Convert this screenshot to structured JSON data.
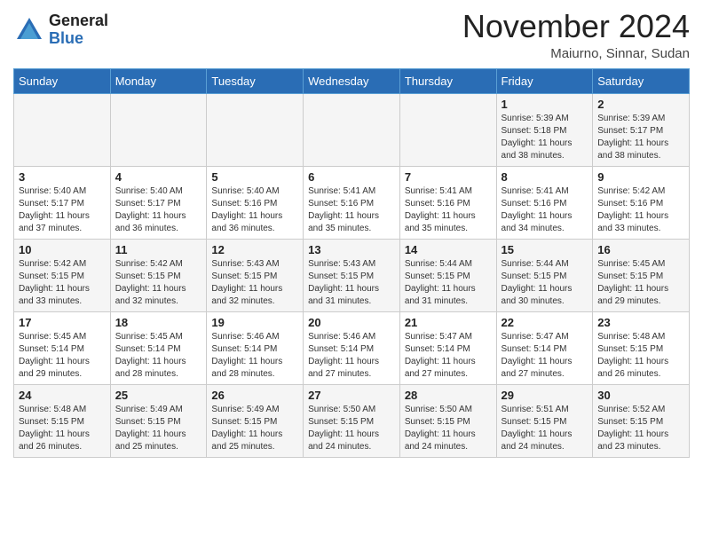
{
  "logo": {
    "general": "General",
    "blue": "Blue"
  },
  "header": {
    "month": "November 2024",
    "location": "Maiurno, Sinnar, Sudan"
  },
  "weekdays": [
    "Sunday",
    "Monday",
    "Tuesday",
    "Wednesday",
    "Thursday",
    "Friday",
    "Saturday"
  ],
  "weeks": [
    [
      {
        "day": "",
        "detail": ""
      },
      {
        "day": "",
        "detail": ""
      },
      {
        "day": "",
        "detail": ""
      },
      {
        "day": "",
        "detail": ""
      },
      {
        "day": "",
        "detail": ""
      },
      {
        "day": "1",
        "detail": "Sunrise: 5:39 AM\nSunset: 5:18 PM\nDaylight: 11 hours\nand 38 minutes."
      },
      {
        "day": "2",
        "detail": "Sunrise: 5:39 AM\nSunset: 5:17 PM\nDaylight: 11 hours\nand 38 minutes."
      }
    ],
    [
      {
        "day": "3",
        "detail": "Sunrise: 5:40 AM\nSunset: 5:17 PM\nDaylight: 11 hours\nand 37 minutes."
      },
      {
        "day": "4",
        "detail": "Sunrise: 5:40 AM\nSunset: 5:17 PM\nDaylight: 11 hours\nand 36 minutes."
      },
      {
        "day": "5",
        "detail": "Sunrise: 5:40 AM\nSunset: 5:16 PM\nDaylight: 11 hours\nand 36 minutes."
      },
      {
        "day": "6",
        "detail": "Sunrise: 5:41 AM\nSunset: 5:16 PM\nDaylight: 11 hours\nand 35 minutes."
      },
      {
        "day": "7",
        "detail": "Sunrise: 5:41 AM\nSunset: 5:16 PM\nDaylight: 11 hours\nand 35 minutes."
      },
      {
        "day": "8",
        "detail": "Sunrise: 5:41 AM\nSunset: 5:16 PM\nDaylight: 11 hours\nand 34 minutes."
      },
      {
        "day": "9",
        "detail": "Sunrise: 5:42 AM\nSunset: 5:16 PM\nDaylight: 11 hours\nand 33 minutes."
      }
    ],
    [
      {
        "day": "10",
        "detail": "Sunrise: 5:42 AM\nSunset: 5:15 PM\nDaylight: 11 hours\nand 33 minutes."
      },
      {
        "day": "11",
        "detail": "Sunrise: 5:42 AM\nSunset: 5:15 PM\nDaylight: 11 hours\nand 32 minutes."
      },
      {
        "day": "12",
        "detail": "Sunrise: 5:43 AM\nSunset: 5:15 PM\nDaylight: 11 hours\nand 32 minutes."
      },
      {
        "day": "13",
        "detail": "Sunrise: 5:43 AM\nSunset: 5:15 PM\nDaylight: 11 hours\nand 31 minutes."
      },
      {
        "day": "14",
        "detail": "Sunrise: 5:44 AM\nSunset: 5:15 PM\nDaylight: 11 hours\nand 31 minutes."
      },
      {
        "day": "15",
        "detail": "Sunrise: 5:44 AM\nSunset: 5:15 PM\nDaylight: 11 hours\nand 30 minutes."
      },
      {
        "day": "16",
        "detail": "Sunrise: 5:45 AM\nSunset: 5:15 PM\nDaylight: 11 hours\nand 29 minutes."
      }
    ],
    [
      {
        "day": "17",
        "detail": "Sunrise: 5:45 AM\nSunset: 5:14 PM\nDaylight: 11 hours\nand 29 minutes."
      },
      {
        "day": "18",
        "detail": "Sunrise: 5:45 AM\nSunset: 5:14 PM\nDaylight: 11 hours\nand 28 minutes."
      },
      {
        "day": "19",
        "detail": "Sunrise: 5:46 AM\nSunset: 5:14 PM\nDaylight: 11 hours\nand 28 minutes."
      },
      {
        "day": "20",
        "detail": "Sunrise: 5:46 AM\nSunset: 5:14 PM\nDaylight: 11 hours\nand 27 minutes."
      },
      {
        "day": "21",
        "detail": "Sunrise: 5:47 AM\nSunset: 5:14 PM\nDaylight: 11 hours\nand 27 minutes."
      },
      {
        "day": "22",
        "detail": "Sunrise: 5:47 AM\nSunset: 5:14 PM\nDaylight: 11 hours\nand 27 minutes."
      },
      {
        "day": "23",
        "detail": "Sunrise: 5:48 AM\nSunset: 5:15 PM\nDaylight: 11 hours\nand 26 minutes."
      }
    ],
    [
      {
        "day": "24",
        "detail": "Sunrise: 5:48 AM\nSunset: 5:15 PM\nDaylight: 11 hours\nand 26 minutes."
      },
      {
        "day": "25",
        "detail": "Sunrise: 5:49 AM\nSunset: 5:15 PM\nDaylight: 11 hours\nand 25 minutes."
      },
      {
        "day": "26",
        "detail": "Sunrise: 5:49 AM\nSunset: 5:15 PM\nDaylight: 11 hours\nand 25 minutes."
      },
      {
        "day": "27",
        "detail": "Sunrise: 5:50 AM\nSunset: 5:15 PM\nDaylight: 11 hours\nand 24 minutes."
      },
      {
        "day": "28",
        "detail": "Sunrise: 5:50 AM\nSunset: 5:15 PM\nDaylight: 11 hours\nand 24 minutes."
      },
      {
        "day": "29",
        "detail": "Sunrise: 5:51 AM\nSunset: 5:15 PM\nDaylight: 11 hours\nand 24 minutes."
      },
      {
        "day": "30",
        "detail": "Sunrise: 5:52 AM\nSunset: 5:15 PM\nDaylight: 11 hours\nand 23 minutes."
      }
    ]
  ]
}
